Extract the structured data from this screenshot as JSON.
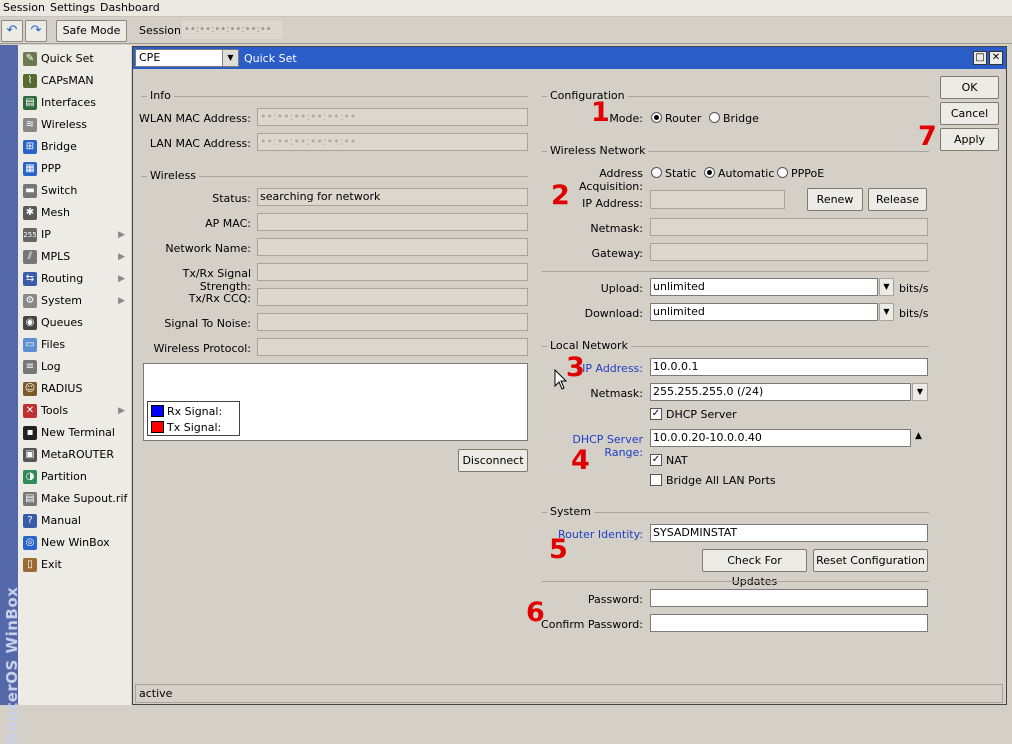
{
  "menubar": {
    "items": [
      "Session",
      "Settings",
      "Dashboard"
    ]
  },
  "toolbar": {
    "undo": "↶",
    "redo": "↷",
    "safe_mode": "Safe Mode",
    "session_label": "Session:",
    "session_value": "••:••:••:••:••:••"
  },
  "brand": "RouterOS WinBox",
  "sidebar": {
    "items": [
      {
        "label": "Quick Set",
        "icon": "quickset-icon",
        "color": "#6a7a50",
        "glyph": "✎"
      },
      {
        "label": "CAPsMAN",
        "icon": "capsman-icon",
        "color": "#556b2f",
        "glyph": "⌇"
      },
      {
        "label": "Interfaces",
        "icon": "interfaces-icon",
        "color": "#2f6a3a",
        "glyph": "▤"
      },
      {
        "label": "Wireless",
        "icon": "wireless-icon",
        "color": "#888",
        "glyph": "≋"
      },
      {
        "label": "Bridge",
        "icon": "bridge-icon",
        "color": "#2b64c8",
        "glyph": "⊞"
      },
      {
        "label": "PPP",
        "icon": "ppp-icon",
        "color": "#2b64c8",
        "glyph": "▦"
      },
      {
        "label": "Switch",
        "icon": "switch-icon",
        "color": "#777",
        "glyph": "▬"
      },
      {
        "label": "Mesh",
        "icon": "mesh-icon",
        "color": "#5a5a5a",
        "glyph": "✱"
      },
      {
        "label": "IP",
        "icon": "ip-icon",
        "color": "#666",
        "glyph": "255",
        "arrow": true
      },
      {
        "label": "MPLS",
        "icon": "mpls-icon",
        "color": "#777",
        "glyph": "⫽",
        "arrow": true
      },
      {
        "label": "Routing",
        "icon": "routing-icon",
        "color": "#3b5aa8",
        "glyph": "⇆",
        "arrow": true
      },
      {
        "label": "System",
        "icon": "system-icon",
        "color": "#888",
        "glyph": "⚙",
        "arrow": true
      },
      {
        "label": "Queues",
        "icon": "queues-icon",
        "color": "#444",
        "glyph": "◉"
      },
      {
        "label": "Files",
        "icon": "files-icon",
        "color": "#5b8fd0",
        "glyph": "▭"
      },
      {
        "label": "Log",
        "icon": "log-icon",
        "color": "#777",
        "glyph": "≡"
      },
      {
        "label": "RADIUS",
        "icon": "radius-icon",
        "color": "#7a5a2a",
        "glyph": "☺"
      },
      {
        "label": "Tools",
        "icon": "tools-icon",
        "color": "#c03030",
        "glyph": "✕",
        "arrow": true
      },
      {
        "label": "New Terminal",
        "icon": "terminal-icon",
        "color": "#222",
        "glyph": "▪"
      },
      {
        "label": "MetaROUTER",
        "icon": "metarouter-icon",
        "color": "#555",
        "glyph": "▣"
      },
      {
        "label": "Partition",
        "icon": "partition-icon",
        "color": "#2e8b57",
        "glyph": "◑"
      },
      {
        "label": "Make Supout.rif",
        "icon": "supout-icon",
        "color": "#777",
        "glyph": "▤"
      },
      {
        "label": "Manual",
        "icon": "manual-icon",
        "color": "#3b5aa8",
        "glyph": "?"
      },
      {
        "label": "New WinBox",
        "icon": "winbox-icon",
        "color": "#2b64c8",
        "glyph": "◎"
      },
      {
        "label": "Exit",
        "icon": "exit-icon",
        "color": "#9a6a30",
        "glyph": "▯"
      }
    ]
  },
  "window": {
    "mode_select": "CPE",
    "title": "Quick Set",
    "maximize": "□",
    "close": "✕"
  },
  "info": {
    "section": "Info",
    "wlan_mac_label": "WLAN MAC Address:",
    "wlan_mac": "••:••:••:••:••:••",
    "lan_mac_label": "LAN MAC Address:",
    "lan_mac": "••:••:••:••:••:••"
  },
  "wireless": {
    "section": "Wireless",
    "status_label": "Status:",
    "status": "searching for network",
    "ap_mac_label": "AP MAC:",
    "network_name_label": "Network Name:",
    "signal_strength_label": "Tx/Rx Signal Strength:",
    "ccq_label": "Tx/Rx CCQ:",
    "snr_label": "Signal To Noise:",
    "protocol_label": "Wireless Protocol:",
    "rx_legend": "Rx Signal:",
    "tx_legend": "Tx Signal:",
    "rx_color": "#0000ff",
    "tx_color": "#ff0000",
    "disconnect": "Disconnect"
  },
  "config": {
    "section": "Configuration",
    "mode_label": "Mode:",
    "router": "Router",
    "bridge": "Bridge"
  },
  "wireless_network": {
    "section": "Wireless Network",
    "acq_label": "Address Acquisition:",
    "static": "Static",
    "automatic": "Automatic",
    "pppoe": "PPPoE",
    "ip_label": "IP Address:",
    "renew": "Renew",
    "release": "Release",
    "netmask_label": "Netmask:",
    "gateway_label": "Gateway:",
    "upload_label": "Upload:",
    "upload": "unlimited",
    "download_label": "Download:",
    "download": "unlimited",
    "unit": "bits/s"
  },
  "local": {
    "section": "Local Network",
    "ip_label": "IP Address:",
    "ip": "10.0.0.1",
    "netmask_label": "Netmask:",
    "netmask": "255.255.255.0 (/24)",
    "dhcp_server": "DHCP Server",
    "dhcp_range_label": "DHCP Server Range:",
    "dhcp_range": "10.0.0.20-10.0.0.40",
    "nat": "NAT",
    "bridge_all": "Bridge All LAN Ports"
  },
  "system": {
    "section": "System",
    "identity_label": "Router Identity:",
    "identity": "SYSADMINSTAT",
    "check_updates": "Check For Updates",
    "reset": "Reset Configuration",
    "password_label": "Password:",
    "confirm_label": "Confirm Password:"
  },
  "buttons": {
    "ok": "OK",
    "cancel": "Cancel",
    "apply": "Apply"
  },
  "annotations": [
    "1",
    "2",
    "3",
    "4",
    "5",
    "6",
    "7"
  ],
  "status": "active"
}
